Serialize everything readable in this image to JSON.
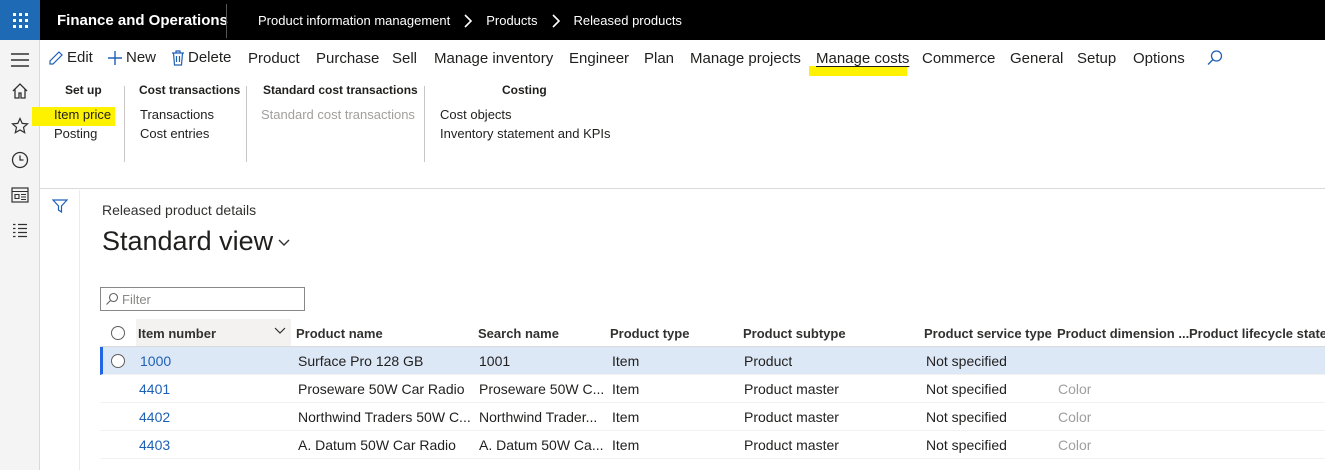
{
  "app": {
    "title": "Finance and Operations",
    "breadcrumb": [
      "Product information management",
      "Products",
      "Released products"
    ]
  },
  "commands": {
    "edit": "Edit",
    "new": "New",
    "delete": "Delete"
  },
  "menu": [
    "Product",
    "Purchase",
    "Sell",
    "Manage inventory",
    "Engineer",
    "Plan",
    "Manage projects",
    "Manage costs",
    "Commerce",
    "General",
    "Setup",
    "Options"
  ],
  "active_menu": "Manage costs",
  "groups": [
    {
      "title": "Set up",
      "items": [
        "Item price",
        "Posting"
      ]
    },
    {
      "title": "Cost transactions",
      "items": [
        "Transactions",
        "Cost entries"
      ]
    },
    {
      "title": "Standard cost transactions",
      "items": [
        "Standard cost transactions"
      ]
    },
    {
      "title": "Costing",
      "items": [
        "Cost objects",
        "Inventory statement and KPIs"
      ]
    }
  ],
  "highlight_color": "#fff200",
  "content": {
    "section_label": "Released product details",
    "view_title": "Standard view",
    "filter_placeholder": "Filter"
  },
  "grid": {
    "columns": [
      "Item number",
      "Product name",
      "Search name",
      "Product type",
      "Product subtype",
      "Product service type",
      "Product dimension ...",
      "Product lifecycle state"
    ],
    "rows": [
      [
        "1000",
        "Surface Pro 128 GB",
        "1001",
        "Item",
        "Product",
        "Not specified",
        ""
      ],
      [
        "4401",
        "Proseware 50W Car Radio",
        "Proseware 50W C...",
        "Item",
        "Product master",
        "Not specified",
        "Color"
      ],
      [
        "4402",
        "Northwind Traders 50W C...",
        "Northwind Trader...",
        "Item",
        "Product master",
        "Not specified",
        "Color"
      ],
      [
        "4403",
        "A. Datum 50W Car Radio",
        "A. Datum 50W Ca...",
        "Item",
        "Product master",
        "Not specified",
        "Color"
      ]
    ]
  }
}
